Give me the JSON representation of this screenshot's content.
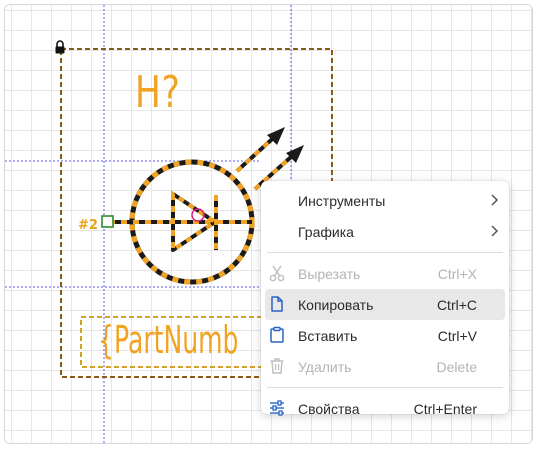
{
  "schematic": {
    "reference_designator": "H?",
    "pin_label": "#2",
    "part_number_field": "{PartNumb"
  },
  "context_menu": {
    "items": [
      {
        "label": "Инструменты",
        "shortcut": "",
        "submenu": true,
        "enabled": true,
        "icon": ""
      },
      {
        "label": "Графика",
        "shortcut": "",
        "submenu": true,
        "enabled": true,
        "icon": ""
      },
      {
        "label": "Вырезать",
        "shortcut": "Ctrl+X",
        "submenu": false,
        "enabled": false,
        "icon": "scissors-icon"
      },
      {
        "label": "Копировать",
        "shortcut": "Ctrl+C",
        "submenu": false,
        "enabled": true,
        "active": true,
        "icon": "copy-icon"
      },
      {
        "label": "Вставить",
        "shortcut": "Ctrl+V",
        "submenu": false,
        "enabled": true,
        "icon": "clipboard-icon"
      },
      {
        "label": "Удалить",
        "shortcut": "Delete",
        "submenu": false,
        "enabled": false,
        "icon": "trash-icon"
      },
      {
        "label": "Свойства",
        "shortcut": "Ctrl+Enter",
        "submenu": false,
        "enabled": true,
        "icon": "sliders-icon"
      }
    ]
  },
  "colors": {
    "symbol_body": "#f0a324",
    "symbol_outline": "#1a1a1a",
    "bounding_box": "#8a5a14",
    "guide_lines": "#5b5be8",
    "pin_square": "#2e8b2e",
    "pin_cursor": "#e0208a",
    "icon_blue": "#2a63c7"
  }
}
